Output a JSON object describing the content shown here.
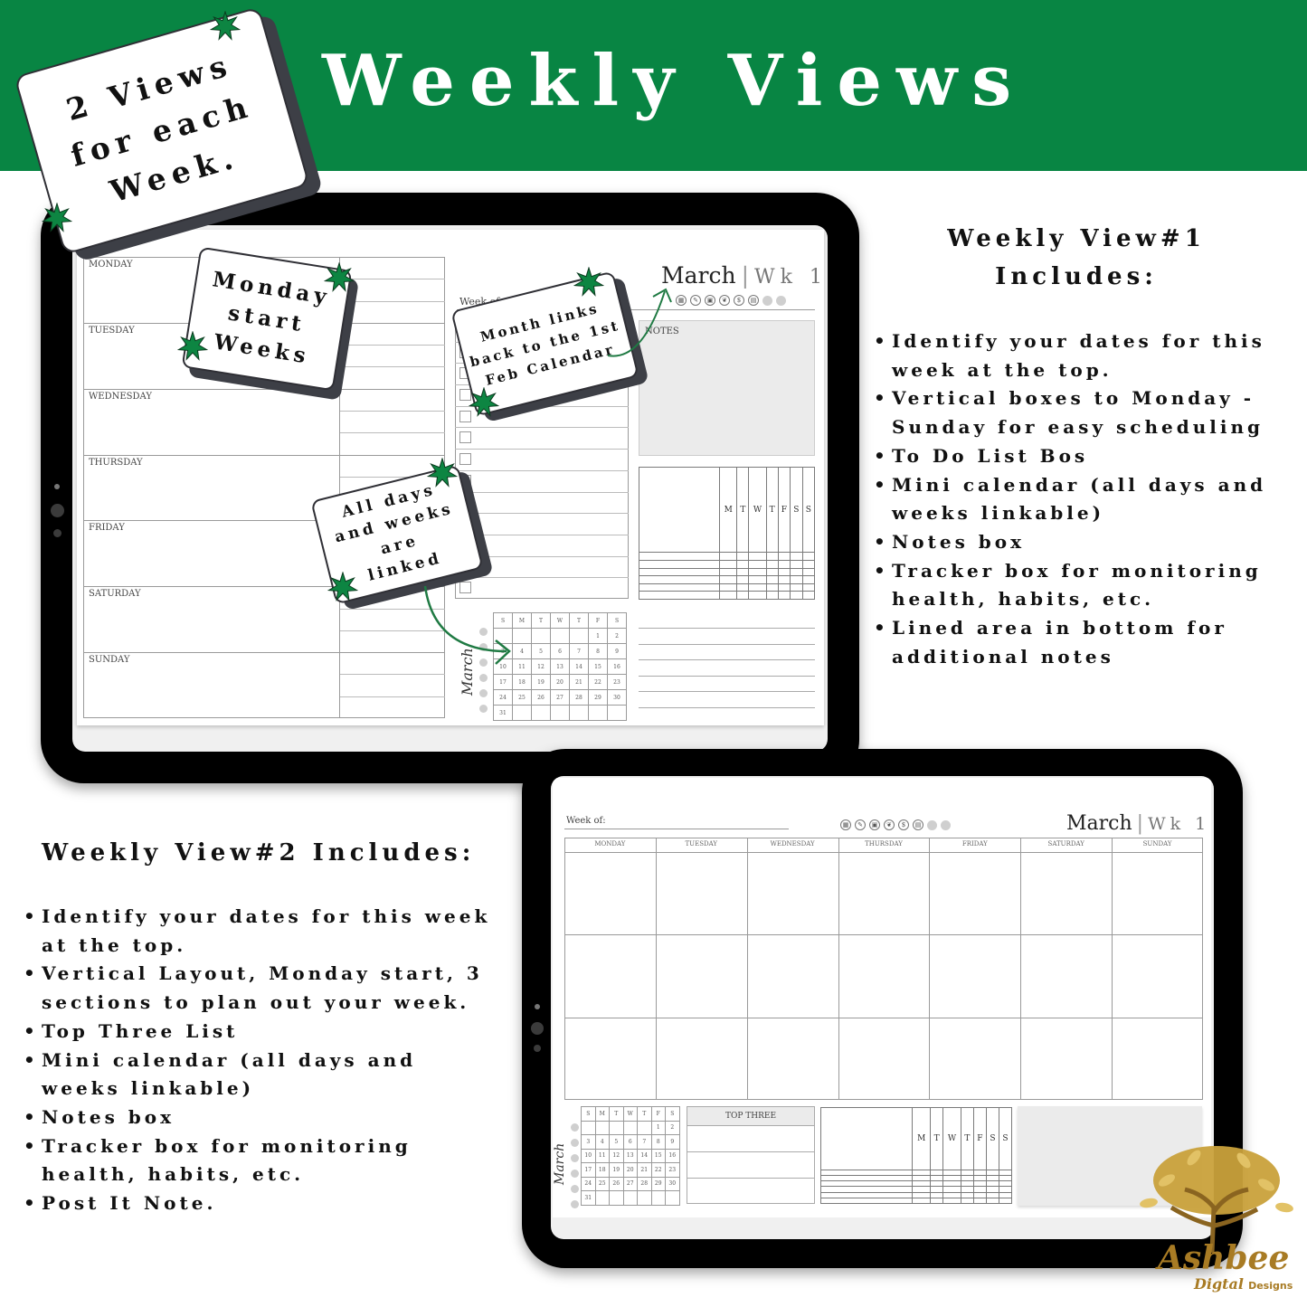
{
  "header": {
    "title": "Weekly Views",
    "brand_color": "#088543"
  },
  "badge_note": {
    "lines": [
      "2 Views",
      "for each",
      "Week."
    ]
  },
  "view1": {
    "days": [
      "MONDAY",
      "TUESDAY",
      "WEDNESDAY",
      "THURSDAY",
      "FRIDAY",
      "SATURDAY",
      "SUNDAY"
    ],
    "week_of_label": "Week of:",
    "month": "March",
    "week": "Wk 1",
    "notes_label": "NOTES",
    "tracker_days": [
      "M",
      "T",
      "W",
      "T",
      "F",
      "S",
      "S"
    ],
    "mini_cal": {
      "month_script": "March",
      "headers": [
        "S",
        "M",
        "T",
        "W",
        "T",
        "F",
        "S"
      ],
      "weeks": [
        [
          "",
          "",
          "",
          "",
          "",
          "1",
          "2"
        ],
        [
          "3",
          "4",
          "5",
          "6",
          "7",
          "8",
          "9"
        ],
        [
          "10",
          "11",
          "12",
          "13",
          "14",
          "15",
          "16"
        ],
        [
          "17",
          "18",
          "19",
          "20",
          "21",
          "22",
          "23"
        ],
        [
          "24",
          "25",
          "26",
          "27",
          "28",
          "29",
          "30"
        ],
        [
          "31",
          "",
          "",
          "",
          "",
          "",
          ""
        ]
      ]
    },
    "sticky_monday": [
      "Monday",
      "start",
      "Weeks"
    ],
    "sticky_month": [
      "Month links",
      "back to the 1st",
      "Feb Calendar"
    ],
    "sticky_linked": [
      "All days",
      "and weeks",
      "are",
      "linked"
    ]
  },
  "view2": {
    "week_of_label": "Week of:",
    "month": "March",
    "week": "Wk 1",
    "days": [
      "MONDAY",
      "TUESDAY",
      "WEDNESDAY",
      "THURSDAY",
      "FRIDAY",
      "SATURDAY",
      "SUNDAY"
    ],
    "top_three_label": "TOP THREE",
    "tracker_days": [
      "M",
      "T",
      "W",
      "T",
      "F",
      "S",
      "S"
    ]
  },
  "icons": [
    "calendar-icon",
    "pin-icon",
    "camera-icon",
    "leaf-icon",
    "dollar-icon",
    "document-icon"
  ],
  "icon_glyphs": [
    "▦",
    "✎",
    "▣",
    "❦",
    "$",
    "▤"
  ],
  "features1": {
    "title_line1": "Weekly View#1",
    "title_line2": "Includes:",
    "items": [
      "Identify your dates for this week at the top.",
      "Vertical boxes to Monday - Sunday for easy scheduling",
      "To Do List Bos",
      "Mini calendar (all days and weeks linkable)",
      "Notes box",
      "Tracker box for monitoring health, habits, etc.",
      "Lined area in bottom for additional notes"
    ]
  },
  "features2": {
    "title": "Weekly View#2 Includes:",
    "items": [
      "Identify your dates for this week at the top.",
      "Vertical Layout, Monday start, 3 sections to plan out your week.",
      "Top Three List",
      "Mini calendar (all days and weeks linkable)",
      "Notes box",
      "Tracker box for monitoring health, habits, etc.",
      "Post It Note."
    ]
  },
  "logo": {
    "name": "Ashbee",
    "tagline_script": "Digtal",
    "tagline": "Designs",
    "color": "#b8892a"
  }
}
